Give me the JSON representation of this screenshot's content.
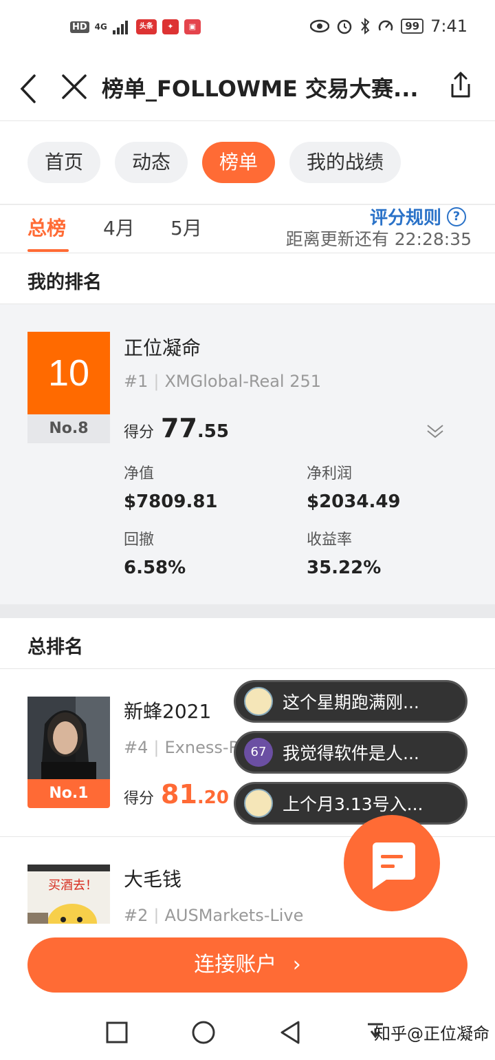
{
  "status_bar": {
    "hd": "HD",
    "signal": "4G",
    "app1": "头条",
    "battery": "99",
    "time": "7:41"
  },
  "title_bar": {
    "title": "榜单_FOLLOWME 交易大赛..."
  },
  "nav_pills": [
    {
      "label": "首页",
      "active": false
    },
    {
      "label": "动态",
      "active": false
    },
    {
      "label": "榜单",
      "active": true
    },
    {
      "label": "我的战绩",
      "active": false
    }
  ],
  "period_tabs": {
    "tabs": [
      "总榜",
      "4月",
      "5月"
    ],
    "active": "总榜",
    "rules_link": "评分规则",
    "countdown": "距离更新还有 22:28:35"
  },
  "my_ranking": {
    "heading": "我的排名",
    "rank_score_badge": "10",
    "rank_no": "No.8",
    "name": "正位凝命",
    "account_num": "#1",
    "broker": "XMGlobal-Real 251",
    "score_label": "得分",
    "score_int": "77",
    "score_dec": ".55",
    "stats": [
      {
        "label": "净值",
        "value": "$7809.81"
      },
      {
        "label": "净利润",
        "value": "$2034.49"
      },
      {
        "label": "回撤",
        "value": "6.58%"
      },
      {
        "label": "收益率",
        "value": "35.22%"
      }
    ]
  },
  "overall_ranking": {
    "heading": "总排名",
    "rows": [
      {
        "rank_badge": "No.1",
        "name": "新蜂2021",
        "account_num": "#4",
        "broker": "Exness-Real",
        "score_label": "得分",
        "score_int": "81",
        "score_dec": ".20"
      },
      {
        "name": "大毛钱",
        "account_num": "#2",
        "broker": "AUSMarkets-Live"
      }
    ]
  },
  "chat_bubbles": [
    {
      "avatar": "image",
      "text": "这个星期跑满刚..."
    },
    {
      "avatar": "67",
      "text": "我觉得软件是人..."
    },
    {
      "avatar": "image",
      "text": "上个月3.13号入..."
    }
  ],
  "avatar2_caption": "买酒去！",
  "connect_button": "连接账户",
  "watermark": "知乎@正位凝命",
  "colors": {
    "accent": "#ff6b35",
    "rank_orange": "#ff6a00",
    "link_blue": "#2a72c8"
  }
}
